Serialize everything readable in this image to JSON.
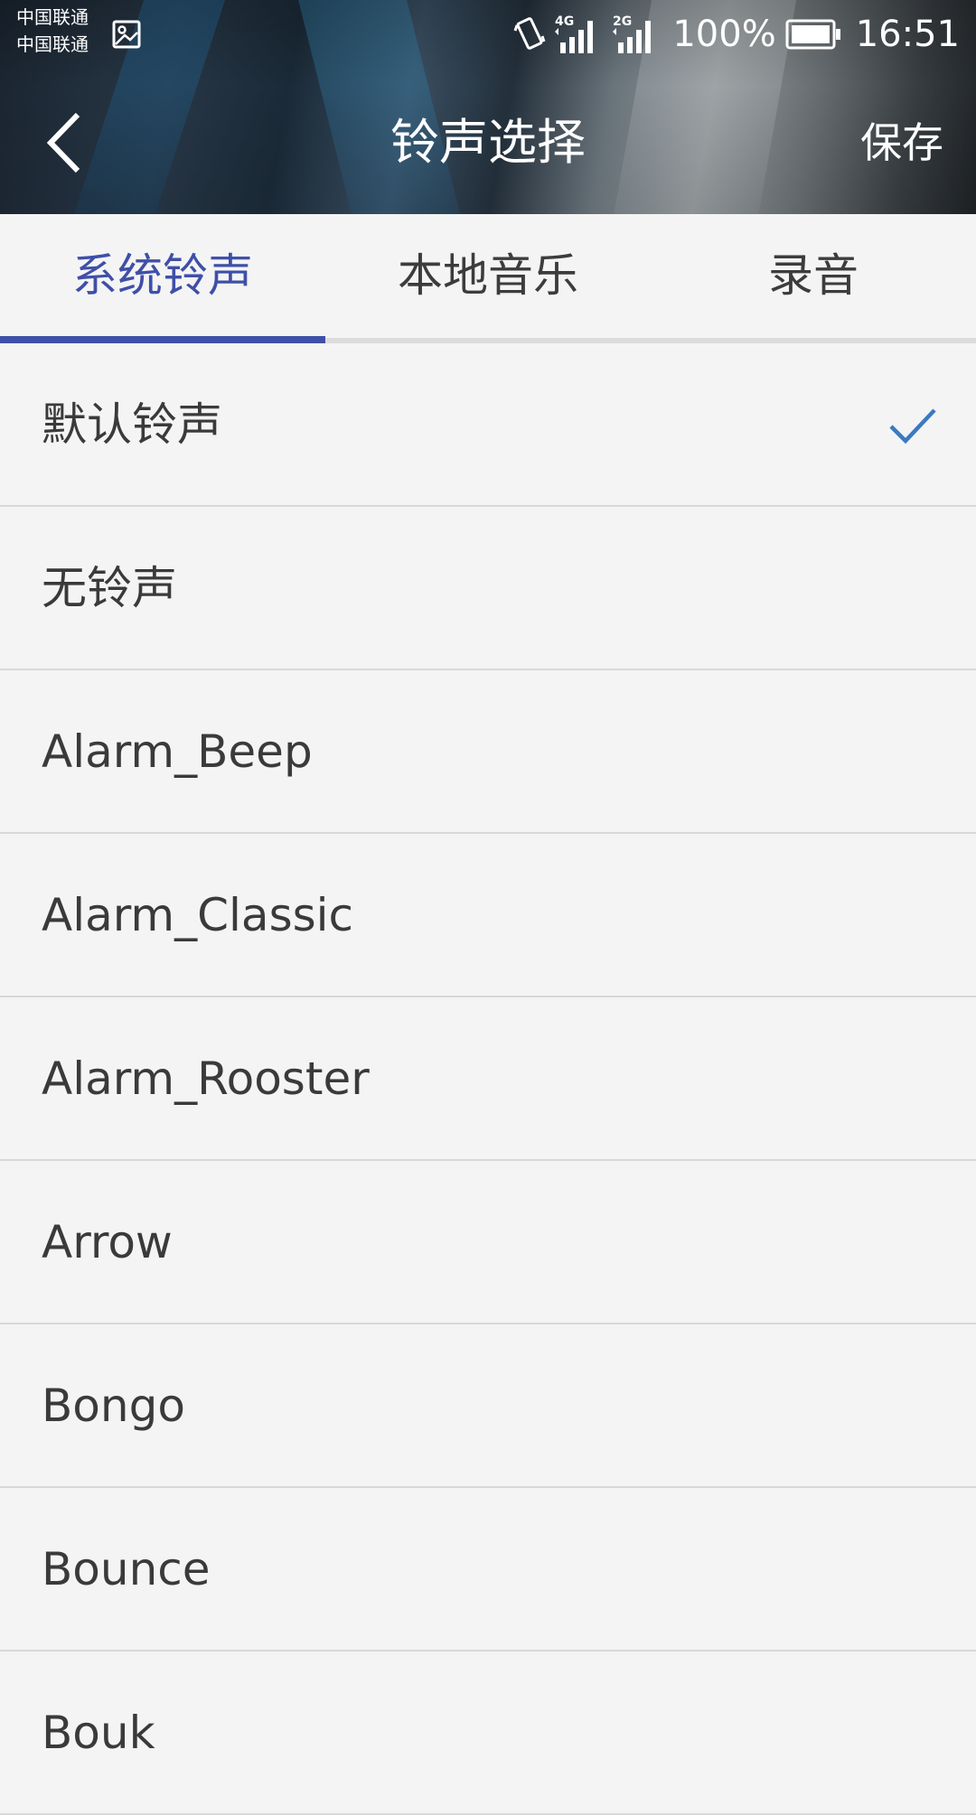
{
  "status_bar": {
    "carrier_1": "中国联通",
    "carrier_2": "中国联通",
    "network_1": "4G",
    "network_2": "2G",
    "battery": "100%",
    "time": "16:51",
    "icons": [
      "image-notification-icon",
      "vibrate-icon",
      "signal-4g-icon",
      "signal-2g-icon",
      "battery-icon"
    ]
  },
  "header": {
    "title": "铃声选择",
    "back_icon": "chevron-left-icon",
    "save_label": "保存"
  },
  "tabs": [
    {
      "label": "系统铃声",
      "active": true
    },
    {
      "label": "本地音乐",
      "active": false
    },
    {
      "label": "录音",
      "active": false
    }
  ],
  "ringtones": [
    {
      "label": "默认铃声",
      "selected": true
    },
    {
      "label": "无铃声",
      "selected": false
    },
    {
      "label": "Alarm_Beep",
      "selected": false
    },
    {
      "label": "Alarm_Classic",
      "selected": false
    },
    {
      "label": "Alarm_Rooster",
      "selected": false
    },
    {
      "label": "Arrow",
      "selected": false
    },
    {
      "label": "Bongo",
      "selected": false
    },
    {
      "label": "Bounce",
      "selected": false
    },
    {
      "label": "Bouk",
      "selected": false
    }
  ],
  "colors": {
    "accent": "#3f4fa8",
    "check": "#3a7abf",
    "list_background": "#f4f4f4",
    "divider": "#d8d8d8"
  }
}
